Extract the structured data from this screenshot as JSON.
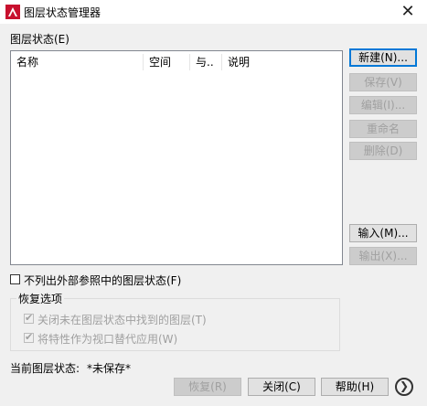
{
  "window": {
    "title": "图层状态管理器",
    "close_glyph": "✕"
  },
  "layer_states": {
    "label": "图层状态(E)",
    "columns": [
      "名称",
      "空间",
      "与..",
      "说明"
    ]
  },
  "buttons": {
    "new": "新建(N)...",
    "save": "保存(V)",
    "edit": "编辑(I)...",
    "rename": "重命名",
    "delete": "删除(D)",
    "import": "输入(M)...",
    "export": "输出(X)..."
  },
  "options": {
    "exclude_xref_label": "不列出外部参照中的图层状态(F)",
    "exclude_xref_checked": false,
    "restore_title": "恢复选项",
    "turn_off_label": "关闭未在图层状态中找到的图层(T)",
    "turn_off_checked": true,
    "apply_override_label": "将特性作为视口替代应用(W)",
    "apply_override_checked": true
  },
  "current": {
    "label": "当前图层状态:",
    "value": "*未保存*"
  },
  "footer": {
    "restore": "恢复(R)",
    "close": "关闭(C)",
    "help": "帮助(H)",
    "more_glyph": "❯"
  },
  "icons": {
    "app_icon": "autocad-logo-icon",
    "accent": "#0078d7",
    "brand_red": "#c8102e"
  }
}
